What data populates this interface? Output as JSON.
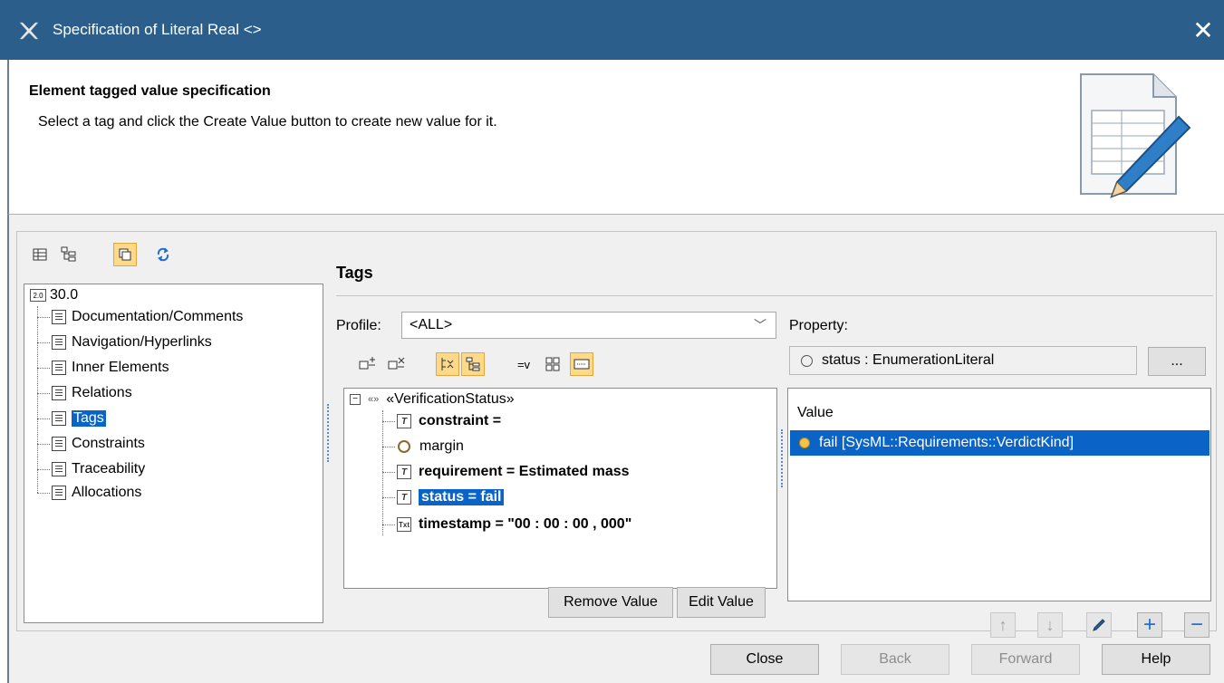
{
  "window": {
    "title": "Specification of Literal Real <>",
    "close_glyph": "✕"
  },
  "header": {
    "title": "Element tagged value specification",
    "description": "Select a tag and click the Create Value button to create new value for it."
  },
  "nav": {
    "toolbar": [
      "table-view-icon",
      "tree-view-icon",
      "copy-icon",
      "refresh-icon"
    ],
    "root_label": "30.0",
    "items": [
      {
        "label": "Documentation/Comments"
      },
      {
        "label": "Navigation/Hyperlinks"
      },
      {
        "label": "Inner Elements"
      },
      {
        "label": "Relations"
      },
      {
        "label": "Tags"
      },
      {
        "label": "Constraints"
      },
      {
        "label": "Traceability"
      },
      {
        "label": "Allocations"
      }
    ]
  },
  "tags_section": {
    "title": "Tags",
    "profile_label": "Profile:",
    "profile_value": "<ALL>",
    "toolbar_value_icon": "=v",
    "stereotype": "«VerificationStatus»",
    "stereotype_glyph": "«»",
    "rows": [
      {
        "label": "constraint =",
        "bold": true,
        "icon": "tag-value-icon"
      },
      {
        "label": "margin",
        "bold": false,
        "icon": "property-circle-icon"
      },
      {
        "label": "requirement = Estimated mass",
        "bold": true,
        "icon": "tag-value-icon"
      },
      {
        "label": "status = fail",
        "bold": true,
        "icon": "tag-value-icon",
        "selected": true
      },
      {
        "label": "timestamp = \"00 : 00 : 00 , 000\"",
        "bold": true,
        "icon": "text-icon"
      }
    ],
    "tag_icon_glyph": "T",
    "text_icon_glyph": "Txt",
    "remove_value": "Remove Value",
    "edit_value": "Edit Value"
  },
  "property": {
    "label": "Property:",
    "value": "status : EnumerationLiteral",
    "browse_button": "...",
    "value_header": "Value",
    "selected_value": "fail [SysML::Requirements::VerdictKind]",
    "up_glyph": "↑",
    "down_glyph": "↓",
    "edit_glyph": "✎",
    "add_glyph": "+",
    "remove_glyph": "−"
  },
  "footer": {
    "close": "Close",
    "back": "Back",
    "forward": "Forward",
    "help": "Help"
  }
}
